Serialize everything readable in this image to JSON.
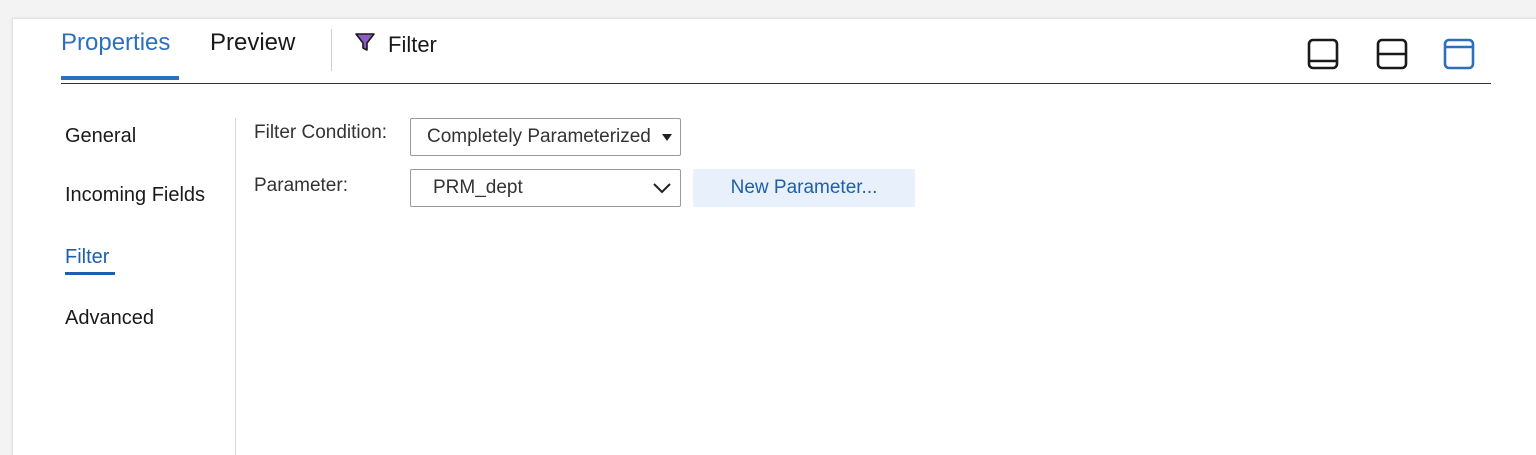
{
  "tabs": {
    "properties": "Properties",
    "preview": "Preview",
    "filter": "Filter"
  },
  "layout_buttons": [
    {
      "icon": "panel-bottom-icon",
      "color": "#1a1a1a"
    },
    {
      "icon": "panel-split-icon",
      "color": "#1a1a1a"
    },
    {
      "icon": "panel-top-icon",
      "color": "#2d6fbf",
      "selected": true
    }
  ],
  "sidebar": {
    "items": [
      {
        "label": "General"
      },
      {
        "label": "Incoming Fields"
      },
      {
        "label": "Filter",
        "active": true
      },
      {
        "label": "Advanced"
      }
    ]
  },
  "form": {
    "filter_condition_label": "Filter Condition:",
    "filter_condition_value": "Completely Parameterized",
    "parameter_label": "Parameter:",
    "parameter_value": "PRM_dept",
    "new_parameter_label": "New Parameter..."
  },
  "colors": {
    "accent": "#2d6fbf",
    "nav_active": "#1f5ea8",
    "filter_icon": "#8b5cc4"
  }
}
